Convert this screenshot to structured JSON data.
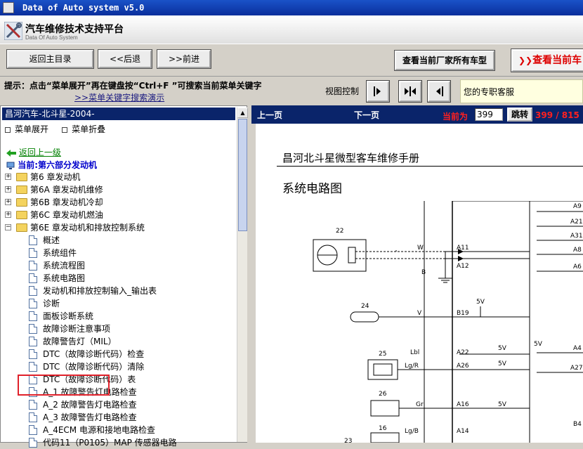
{
  "window": {
    "title": "Data of Auto system v5.0"
  },
  "header": {
    "title_cn": "汽车维修技术支持平台",
    "title_en": "Data Of Auto System"
  },
  "toolbar": {
    "home_label": "返回主目录",
    "back_label": "<<后退",
    "forward_label": ">>前进",
    "all_models_label": "查看当前厂家所有车型",
    "current_model_label": "查看当前车"
  },
  "hint": {
    "text": "提示：点击“菜单展开”再在键盘按“Ctrl+F ”可搜索当前菜单关键字",
    "demo_link": ">>菜单关键字搜索演示",
    "view_control_label": "视图控制",
    "support_label": "您的专职客服"
  },
  "left_panel": {
    "title": "昌河汽车-北斗星-2004-",
    "expand_label": "菜单展开",
    "collapse_label": "菜单折叠",
    "up_level_label": "返回上一级",
    "current_label": "当前:第六部分发动机",
    "tree": [
      {
        "label": "第6 章发动机",
        "type": "folder"
      },
      {
        "label": "第6A 章发动机维修",
        "type": "folder"
      },
      {
        "label": "第6B 章发动机冷却",
        "type": "folder"
      },
      {
        "label": "第6C 章发动机燃油",
        "type": "folder"
      },
      {
        "label": "第6E 章发动机和排放控制系统",
        "type": "folder-open"
      },
      {
        "label": "概述",
        "type": "doc"
      },
      {
        "label": "系统组件",
        "type": "doc"
      },
      {
        "label": "系统流程图",
        "type": "doc"
      },
      {
        "label": "系统电路图",
        "type": "doc",
        "selected": true
      },
      {
        "label": "发动机和排放控制输入_输出表",
        "type": "doc"
      },
      {
        "label": "诊断",
        "type": "doc"
      },
      {
        "label": "面板诊断系统",
        "type": "doc"
      },
      {
        "label": "故障诊断注意事项",
        "type": "doc"
      },
      {
        "label": "故障警告灯（MIL）",
        "type": "doc"
      },
      {
        "label": "DTC（故障诊断代码）检查",
        "type": "doc"
      },
      {
        "label": "DTC（故障诊断代码）清除",
        "type": "doc"
      },
      {
        "label": "DTC（故障诊断代码）表",
        "type": "doc"
      },
      {
        "label": "A_1 故障警告灯电路检查",
        "type": "doc"
      },
      {
        "label": "A_2 故障警告灯电路检查",
        "type": "doc"
      },
      {
        "label": "A_3 故障警告灯电路检查",
        "type": "doc"
      },
      {
        "label": "A_4ECM 电源和接地电路检查",
        "type": "doc"
      },
      {
        "label": "代码11（P0105）MAP 传感器电路",
        "type": "doc"
      }
    ]
  },
  "right_panel": {
    "prev_label": "上一页",
    "next_label": "下一页",
    "current_page_label": "当前为",
    "page_value": "399",
    "go_label": "跳转",
    "page_count": "399 / 815",
    "doc_title": "昌河北斗星微型客车维修手册",
    "doc_subtitle": "系统电路图"
  },
  "diagram": {
    "components": [
      "22",
      "24",
      "25",
      "26",
      "16",
      "23",
      "23"
    ],
    "left_pins": [
      "A11",
      "A12",
      "B19",
      "A22",
      "A26",
      "A16",
      "A14"
    ],
    "wires": [
      "W",
      "B",
      "V",
      "Lbl",
      "Lg/R",
      "Gr",
      "Lg/B"
    ],
    "voltages": [
      "5V",
      "5V",
      "5V",
      "5V",
      "5V",
      "5V"
    ],
    "right_pins": [
      "A9",
      "A21",
      "A31",
      "A8",
      "A6",
      "A4",
      "A27",
      "B4"
    ]
  },
  "colors": {
    "titlebar": "#0a2f9c",
    "selection": "#0a246a",
    "highlight_box": "#e0202a",
    "page_text": "#ff2020"
  }
}
